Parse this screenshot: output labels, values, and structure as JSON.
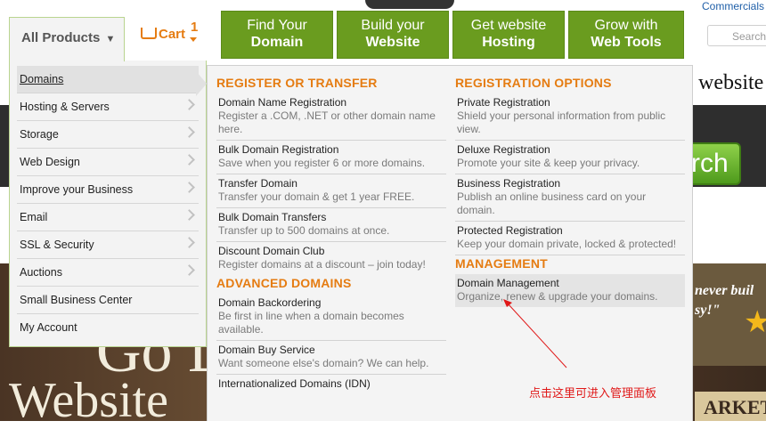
{
  "header": {
    "commercials_link": "Commercials",
    "search_placeholder": "Search",
    "all_products_label": "All Products",
    "cart_label": "Cart",
    "cart_count": "1"
  },
  "nav_tabs": [
    {
      "line1": "Find Your",
      "line2": "Domain"
    },
    {
      "line1": "Build your",
      "line2": "Website"
    },
    {
      "line1": "Get website",
      "line2": "Hosting"
    },
    {
      "line1": "Grow with",
      "line2": "Web Tools"
    }
  ],
  "category_menu": [
    "Domains",
    "Hosting & Servers",
    "Storage",
    "Web Design",
    "Improve your Business",
    "Email",
    "SSL & Security",
    "Auctions",
    "Small Business Center",
    "My Account"
  ],
  "panel": {
    "register_heading": "REGISTER OR TRANSFER",
    "register_items": [
      {
        "title": "Domain Name Registration",
        "desc": "Register a .COM, .NET or other domain name here."
      },
      {
        "title": "Bulk Domain Registration",
        "desc": "Save when you register 6 or more domains."
      },
      {
        "title": "Transfer Domain",
        "desc": "Transfer your domain & get 1 year FREE."
      },
      {
        "title": "Bulk Domain Transfers",
        "desc": "Transfer up to 500 domains at once."
      },
      {
        "title": "Discount Domain Club",
        "desc": "Register domains at a discount – join today!"
      }
    ],
    "advanced_heading": "ADVANCED DOMAINS",
    "advanced_items": [
      {
        "title": "Domain Backordering",
        "desc": "Be first in line when a domain becomes available."
      },
      {
        "title": "Domain Buy Service",
        "desc": "Want someone else's domain? We can help."
      },
      {
        "title": "Internationalized Domains (IDN)",
        "desc": ""
      }
    ],
    "options_heading": "REGISTRATION OPTIONS",
    "options_items": [
      {
        "title": "Private Registration",
        "desc": "Shield your personal information from public view."
      },
      {
        "title": "Deluxe Registration",
        "desc": "Promote your site & keep your privacy."
      },
      {
        "title": "Business Registration",
        "desc": "Publish an online business card on your domain."
      },
      {
        "title": "Protected Registration",
        "desc": "Keep your domain private, locked & protected!"
      }
    ],
    "management_heading": "MANAGEMENT",
    "management_items": [
      {
        "title": "Domain Management",
        "desc": "Organize, renew & upgrade your domains."
      }
    ]
  },
  "background": {
    "website_text": "website",
    "search_button": "rch",
    "promo_text_1": "never buil",
    "promo_text_2": "sy!\"",
    "market_text": "ARKET",
    "hero_go": "Go D",
    "hero_websites": "Website"
  },
  "annotation": {
    "text": "点击这里可进入管理面板",
    "color": "#e01818"
  },
  "colors": {
    "nav_green": "#6a9c1f",
    "accent_orange": "#e57c12",
    "annotation_red": "#e01818"
  }
}
